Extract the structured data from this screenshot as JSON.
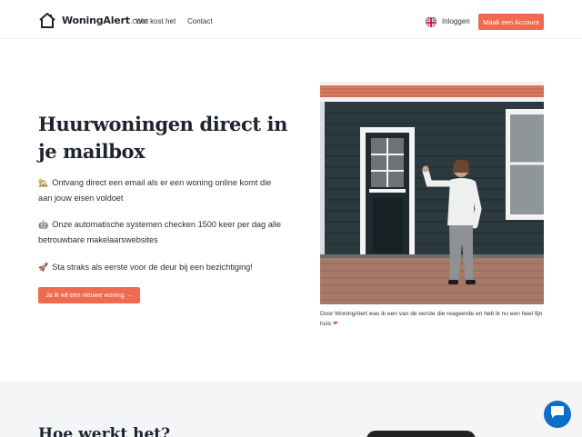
{
  "header": {
    "logo_name": "WoningAlert",
    "logo_domain": ".com",
    "nav": [
      "Wat kost het",
      "Contact"
    ],
    "login_label": "Inloggen",
    "cta_label": "Maak een Account"
  },
  "hero": {
    "title": "Huurwoningen direct in je mailbox",
    "features": [
      {
        "icon": "house-icon",
        "emoji": "🏡",
        "text": "Ontvang direct een email als er een woning online komt die aan jouw eisen voldoet"
      },
      {
        "icon": "robot-icon",
        "emoji": "🤖",
        "text": "Onze automatische systemen checken 1500 keer per dag alle betrouwbare makelaarswebsites"
      },
      {
        "icon": "rocket-icon",
        "emoji": "🚀",
        "text": "Sta straks als eerste voor de deur bij een bezichtiging!"
      }
    ],
    "cta_label": "Ja ik wil een nieuwe woning →"
  },
  "testimonial": {
    "caption": "Door WoningAlert was ik een van de eerste die reageerde en heb ik nu een heel fijn huis",
    "heart": "❤"
  },
  "how": {
    "title": "Hoe werkt het?"
  },
  "colors": {
    "accent": "#ef6a4f",
    "chat": "#0b6fc7",
    "section_bg": "#f4f5f7"
  }
}
